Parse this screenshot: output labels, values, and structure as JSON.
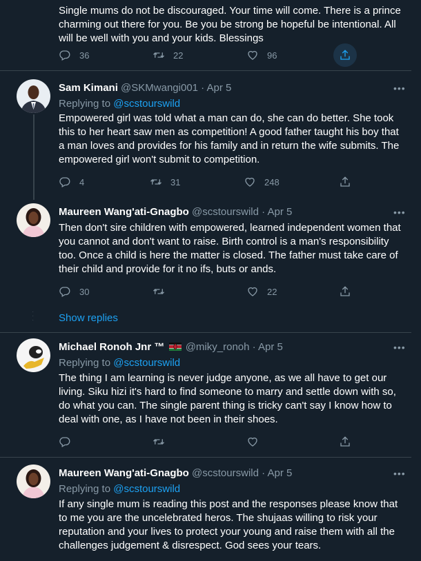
{
  "tweets": [
    {
      "text": "Single mums do not be discouraged. Your time will come. There is a prince charming out there for you. Be you be strong be hopeful be intentional. All will be well with you and your kids. Blessings",
      "replies": "36",
      "retweets": "22",
      "likes": "96"
    },
    {
      "name": "Sam Kimani",
      "handle": "@SKMwangi001",
      "dot": "·",
      "date": "Apr 5",
      "replying_prefix": "Replying to",
      "replying_to": "@scstourswild",
      "text": "Empowered girl was told what a man can do, she can do better. She took this to her heart saw men as competition! A good father taught his boy that a man loves and provides for his family and in return the wife submits. The empowered girl won't  submit to competition.",
      "replies": "4",
      "retweets": "31",
      "likes": "248"
    },
    {
      "name": "Maureen Wang'ati-Gnagbo",
      "handle": "@scstourswild",
      "dot": "·",
      "date": "Apr 5",
      "text": "Then don't sire children with empowered, learned independent women that you cannot and don't want to raise. Birth control is a man's responsibility too. Once a child is here the matter is closed. The father must take care of their child  and provide for it no ifs, buts or ands.",
      "replies": "30",
      "retweets": "",
      "likes": "22"
    },
    {
      "name": "Michael Ronoh Jnr ™",
      "handle": "@miky_ronoh",
      "dot": "·",
      "date": "Apr 5",
      "replying_prefix": "Replying to",
      "replying_to": "@scstourswild",
      "text": "The thing I am learning is never judge anyone, as we all have to get our living. Siku hizi it's hard to find someone to marry and settle down with so, do what you can. The single parent thing is tricky can't say I know how to deal with one, as I have not been in their shoes.",
      "replies": "",
      "retweets": "",
      "likes": ""
    },
    {
      "name": "Maureen Wang'ati-Gnagbo",
      "handle": "@scstourswild",
      "dot": "·",
      "date": "Apr 5",
      "replying_prefix": "Replying to",
      "replying_to": "@scstourswild",
      "text": "If any single mum is reading this post and the responses please know that to me you are the uncelebrated heros. The shujaas willing to risk your reputation and your lives to protect your young and raise them with all the challenges judgement & disrespect. God sees your tears."
    }
  ],
  "show_replies": "Show replies",
  "more_glyph": "•••",
  "icons": [
    "reply-icon",
    "retweet-icon",
    "like-icon",
    "share-icon",
    "more-icon",
    "kenya-flag-icon"
  ],
  "colors": {
    "background": "#15202b",
    "secondary": "#8899a6",
    "link": "#1da1f2",
    "divider": "#38444d"
  }
}
